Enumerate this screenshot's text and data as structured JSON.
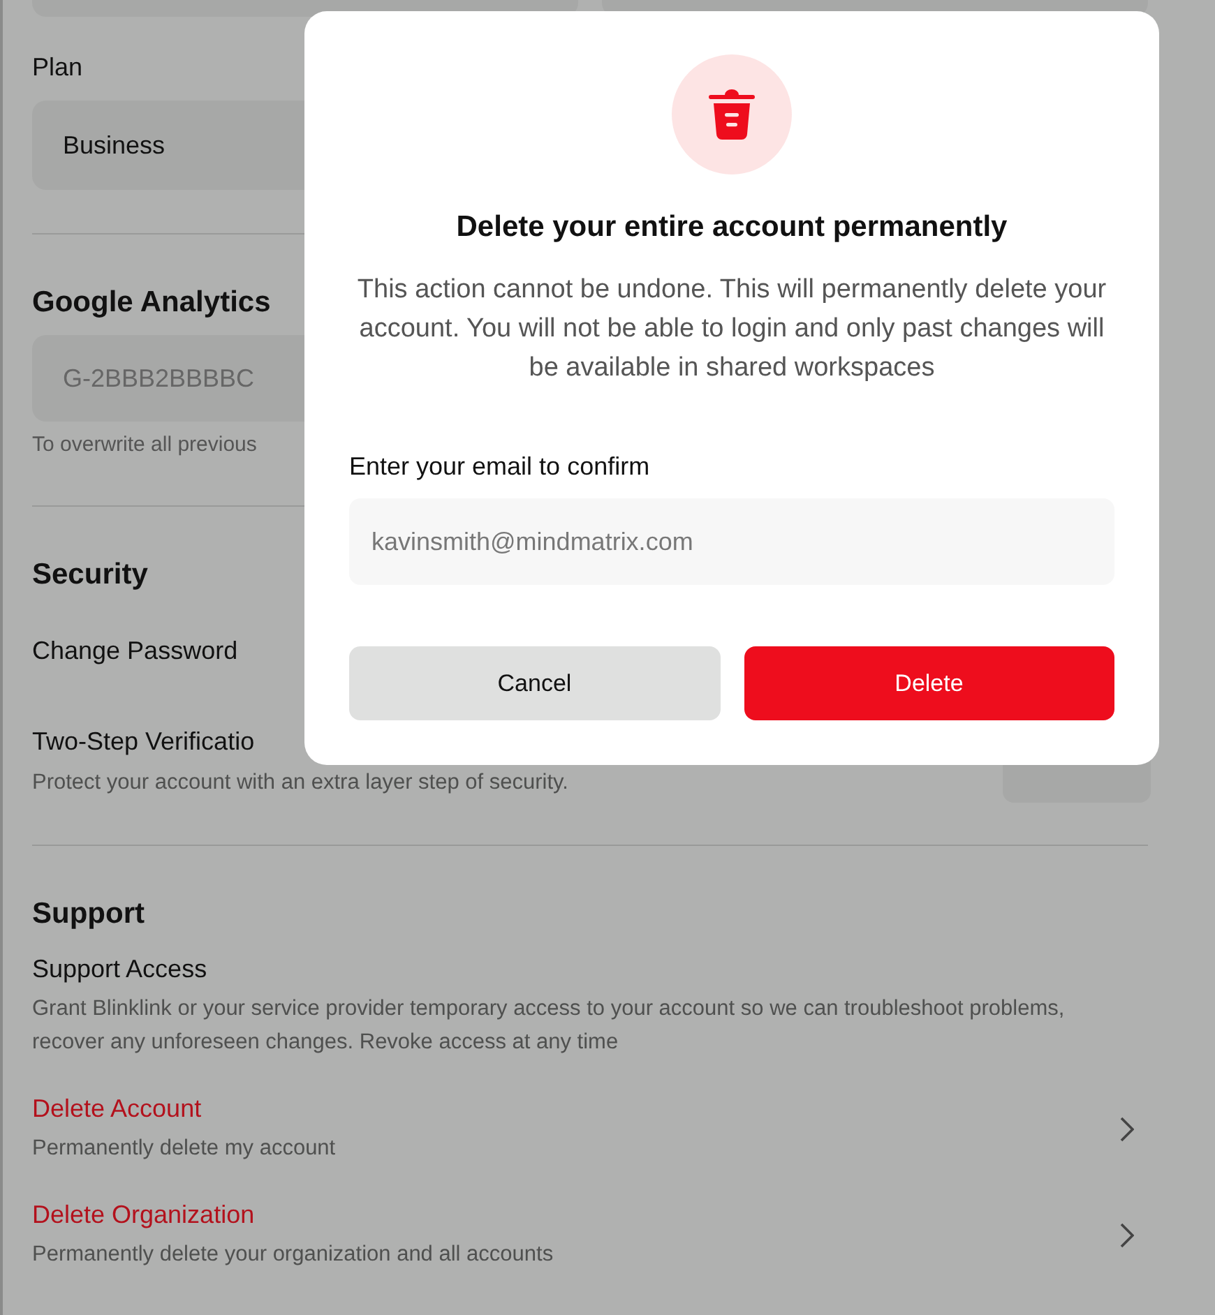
{
  "page": {
    "plan": {
      "label": "Plan",
      "value": "Business"
    },
    "analytics": {
      "heading": "Google Analytics",
      "value": "G-2BBB2BBBBC",
      "hint": "To overwrite all previous"
    },
    "security": {
      "heading": "Security",
      "change_password": "Change Password",
      "two_step": {
        "title": "Two-Step Verificatio",
        "description": "Protect your account with an extra layer step of security."
      }
    },
    "support": {
      "heading": "Support",
      "access_title": "Support Access",
      "access_description": "Grant Blinklink or your service provider temporary access to your account so we can troubleshoot problems, recover any unforeseen changes. Revoke access at any time",
      "actions": [
        {
          "title": "Delete Account",
          "description": "Permanently delete my account"
        },
        {
          "title": "Delete Organization",
          "description": "Permanently delete your organization and all accounts"
        }
      ]
    }
  },
  "dialog": {
    "title": "Delete your entire account permanently",
    "message": "This action cannot be undone. This will permanently delete your account. You will not be able to login and only past changes will be available in shared workspaces",
    "field_label": "Enter your email to confirm",
    "email": {
      "placeholder": "kavinsmith@mindmatrix.com"
    },
    "buttons": [
      {
        "label": "Cancel",
        "kind": "secondary"
      },
      {
        "label": "Delete",
        "kind": "danger"
      }
    ]
  }
}
